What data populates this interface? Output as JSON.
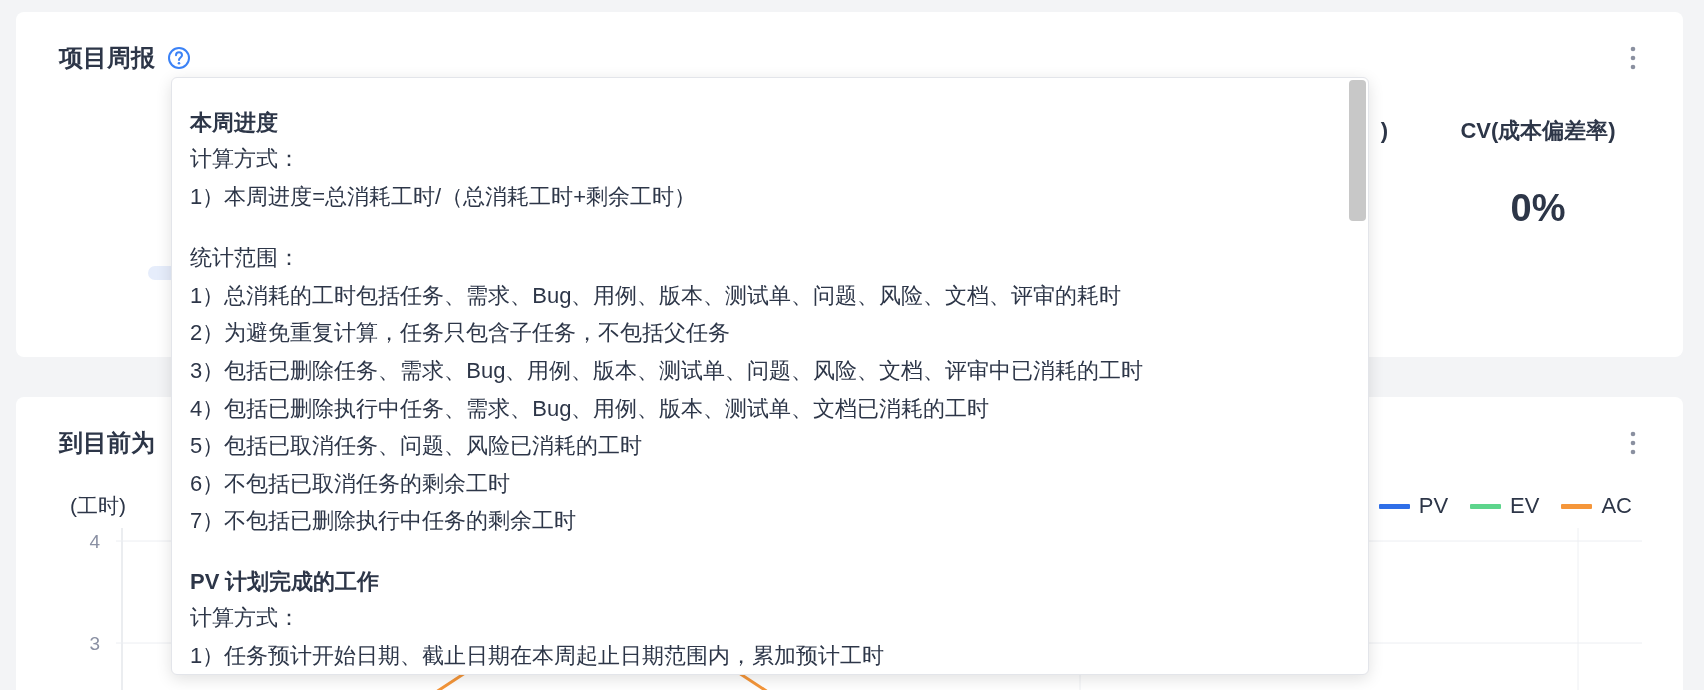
{
  "report_card": {
    "title": "项目周报",
    "partial_label": ")",
    "metric": {
      "label": "CV(成本偏差率)",
      "value": "0%"
    }
  },
  "chart_card": {
    "title": "到目前为",
    "y_unit": "(工时)",
    "y_ticks": [
      "4",
      "3"
    ],
    "legend": [
      {
        "label": "PV",
        "color": "#2f6fe8"
      },
      {
        "label": "EV",
        "color": "#5dd58c"
      },
      {
        "label": "AC",
        "color": "#f5963a"
      }
    ]
  },
  "tooltip": {
    "sections": [
      {
        "heading": "本周进度",
        "blocks": [
          {
            "title": "计算方式：",
            "items": [
              "1）本周进度=总消耗工时/（总消耗工时+剩余工时）"
            ]
          },
          {
            "title": "统计范围：",
            "items": [
              "1）总消耗的工时包括任务、需求、Bug、用例、版本、测试单、问题、风险、文档、评审的耗时",
              "2）为避免重复计算，任务只包含子任务，不包括父任务",
              "3）包括已删除任务、需求、Bug、用例、版本、测试单、问题、风险、文档、评审中已消耗的工时",
              "4）包括已删除执行中任务、需求、Bug、用例、版本、测试单、文档已消耗的工时",
              "5）包括已取消任务、问题、风险已消耗的工时",
              "6）不包括已取消任务的剩余工时",
              "7）不包括已删除执行中任务的剩余工时"
            ]
          }
        ]
      },
      {
        "heading": "PV 计划完成的工作",
        "blocks": [
          {
            "title": "计算方式：",
            "items": [
              "1）任务预计开始日期、截止日期在本周起止日期范围内，累加预计工时"
            ]
          }
        ]
      }
    ]
  }
}
